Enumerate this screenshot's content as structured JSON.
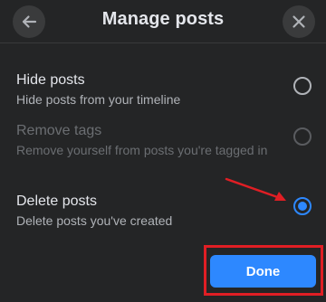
{
  "header": {
    "title": "Manage posts",
    "back_icon": "arrow-left-icon",
    "close_icon": "close-icon"
  },
  "options": [
    {
      "label": "Hide posts",
      "description": "Hide posts from your timeline",
      "state": "enabled",
      "selected": false
    },
    {
      "label": "Remove tags",
      "description": "Remove yourself from posts you're tagged in",
      "state": "disabled",
      "selected": false
    },
    {
      "label": "Delete posts",
      "description": "Delete posts you've created",
      "state": "enabled",
      "selected": true
    }
  ],
  "footer": {
    "done_label": "Done"
  },
  "colors": {
    "background": "#242526",
    "accent": "#2d88ff",
    "annotation": "#e01e24"
  }
}
